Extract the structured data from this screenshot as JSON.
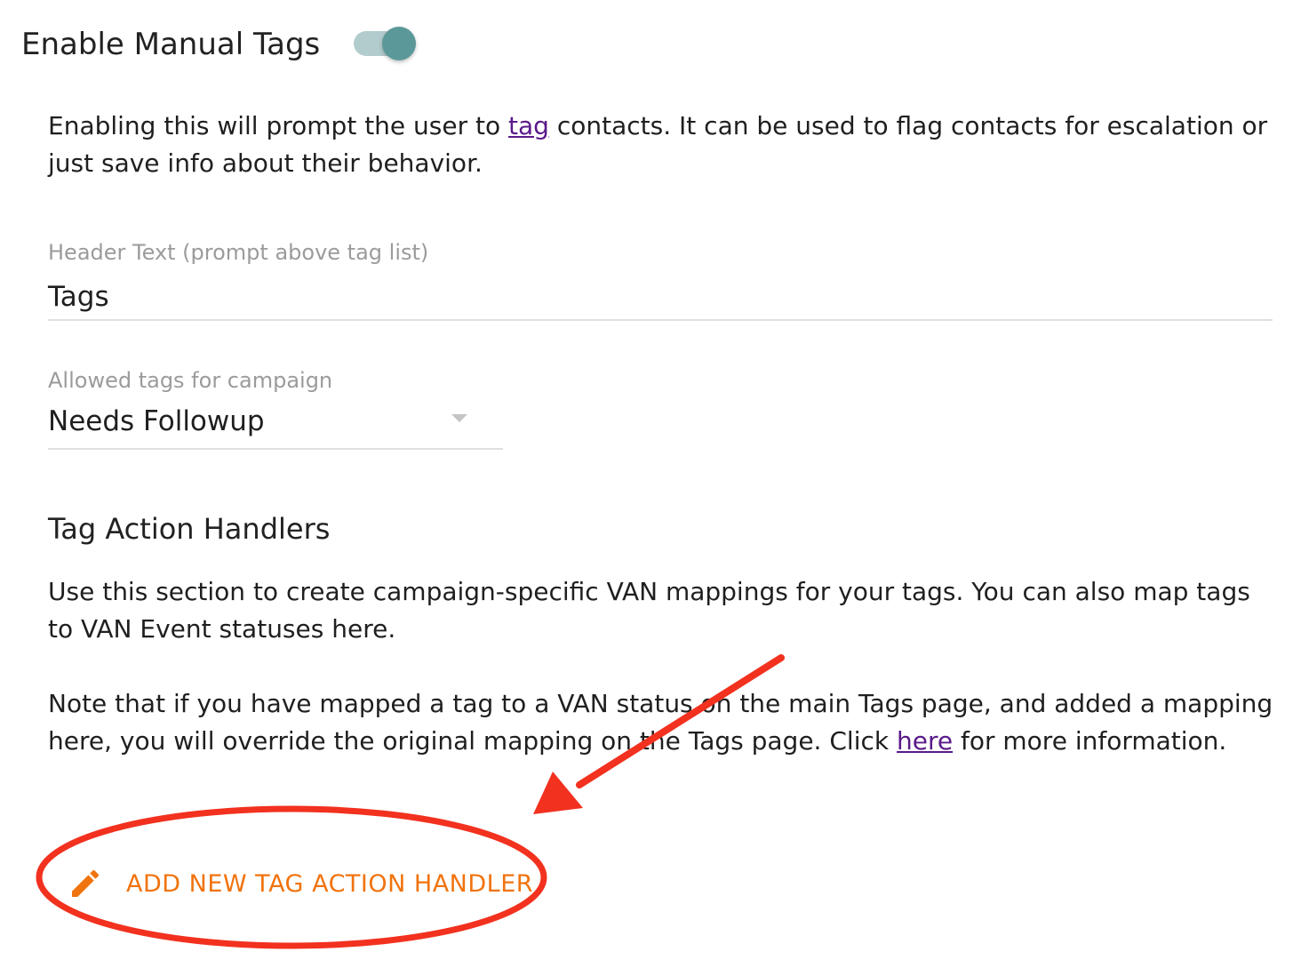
{
  "header": {
    "title": "Enable Manual Tags",
    "toggle_on": true
  },
  "intro": {
    "text_before_link": "Enabling this will prompt the user to ",
    "link_text": "tag",
    "text_after_link": " contacts. It can be used to flag contacts for escalation or just save info about their behavior."
  },
  "header_text_field": {
    "label": "Header Text (prompt above tag list)",
    "value": "Tags"
  },
  "allowed_tags_field": {
    "label": "Allowed tags for campaign",
    "value": "Needs Followup"
  },
  "tag_action_handlers": {
    "title": "Tag Action Handlers",
    "description": "Use this section to create campaign-specific VAN mappings for your tags. You can also map tags to VAN Event statuses here.",
    "note_before_link": "Note that if you have mapped a tag to a VAN status on the main Tags page, and added a mapping here, you will override the original mapping on the Tags page. Click ",
    "note_link_text": "here",
    "note_after_link": " for more information.",
    "add_button_label": "ADD NEW TAG ACTION HANDLER"
  },
  "colors": {
    "toggle_track": "#b2cbcc",
    "toggle_thumb": "#5b989a",
    "link": "#5a1a8a",
    "accent_button": "#f0730e",
    "annotation": "#f2311f"
  },
  "icons": {
    "add_button_icon": "pencil-icon",
    "field_dropdown_icon": "caret-down-icon"
  }
}
